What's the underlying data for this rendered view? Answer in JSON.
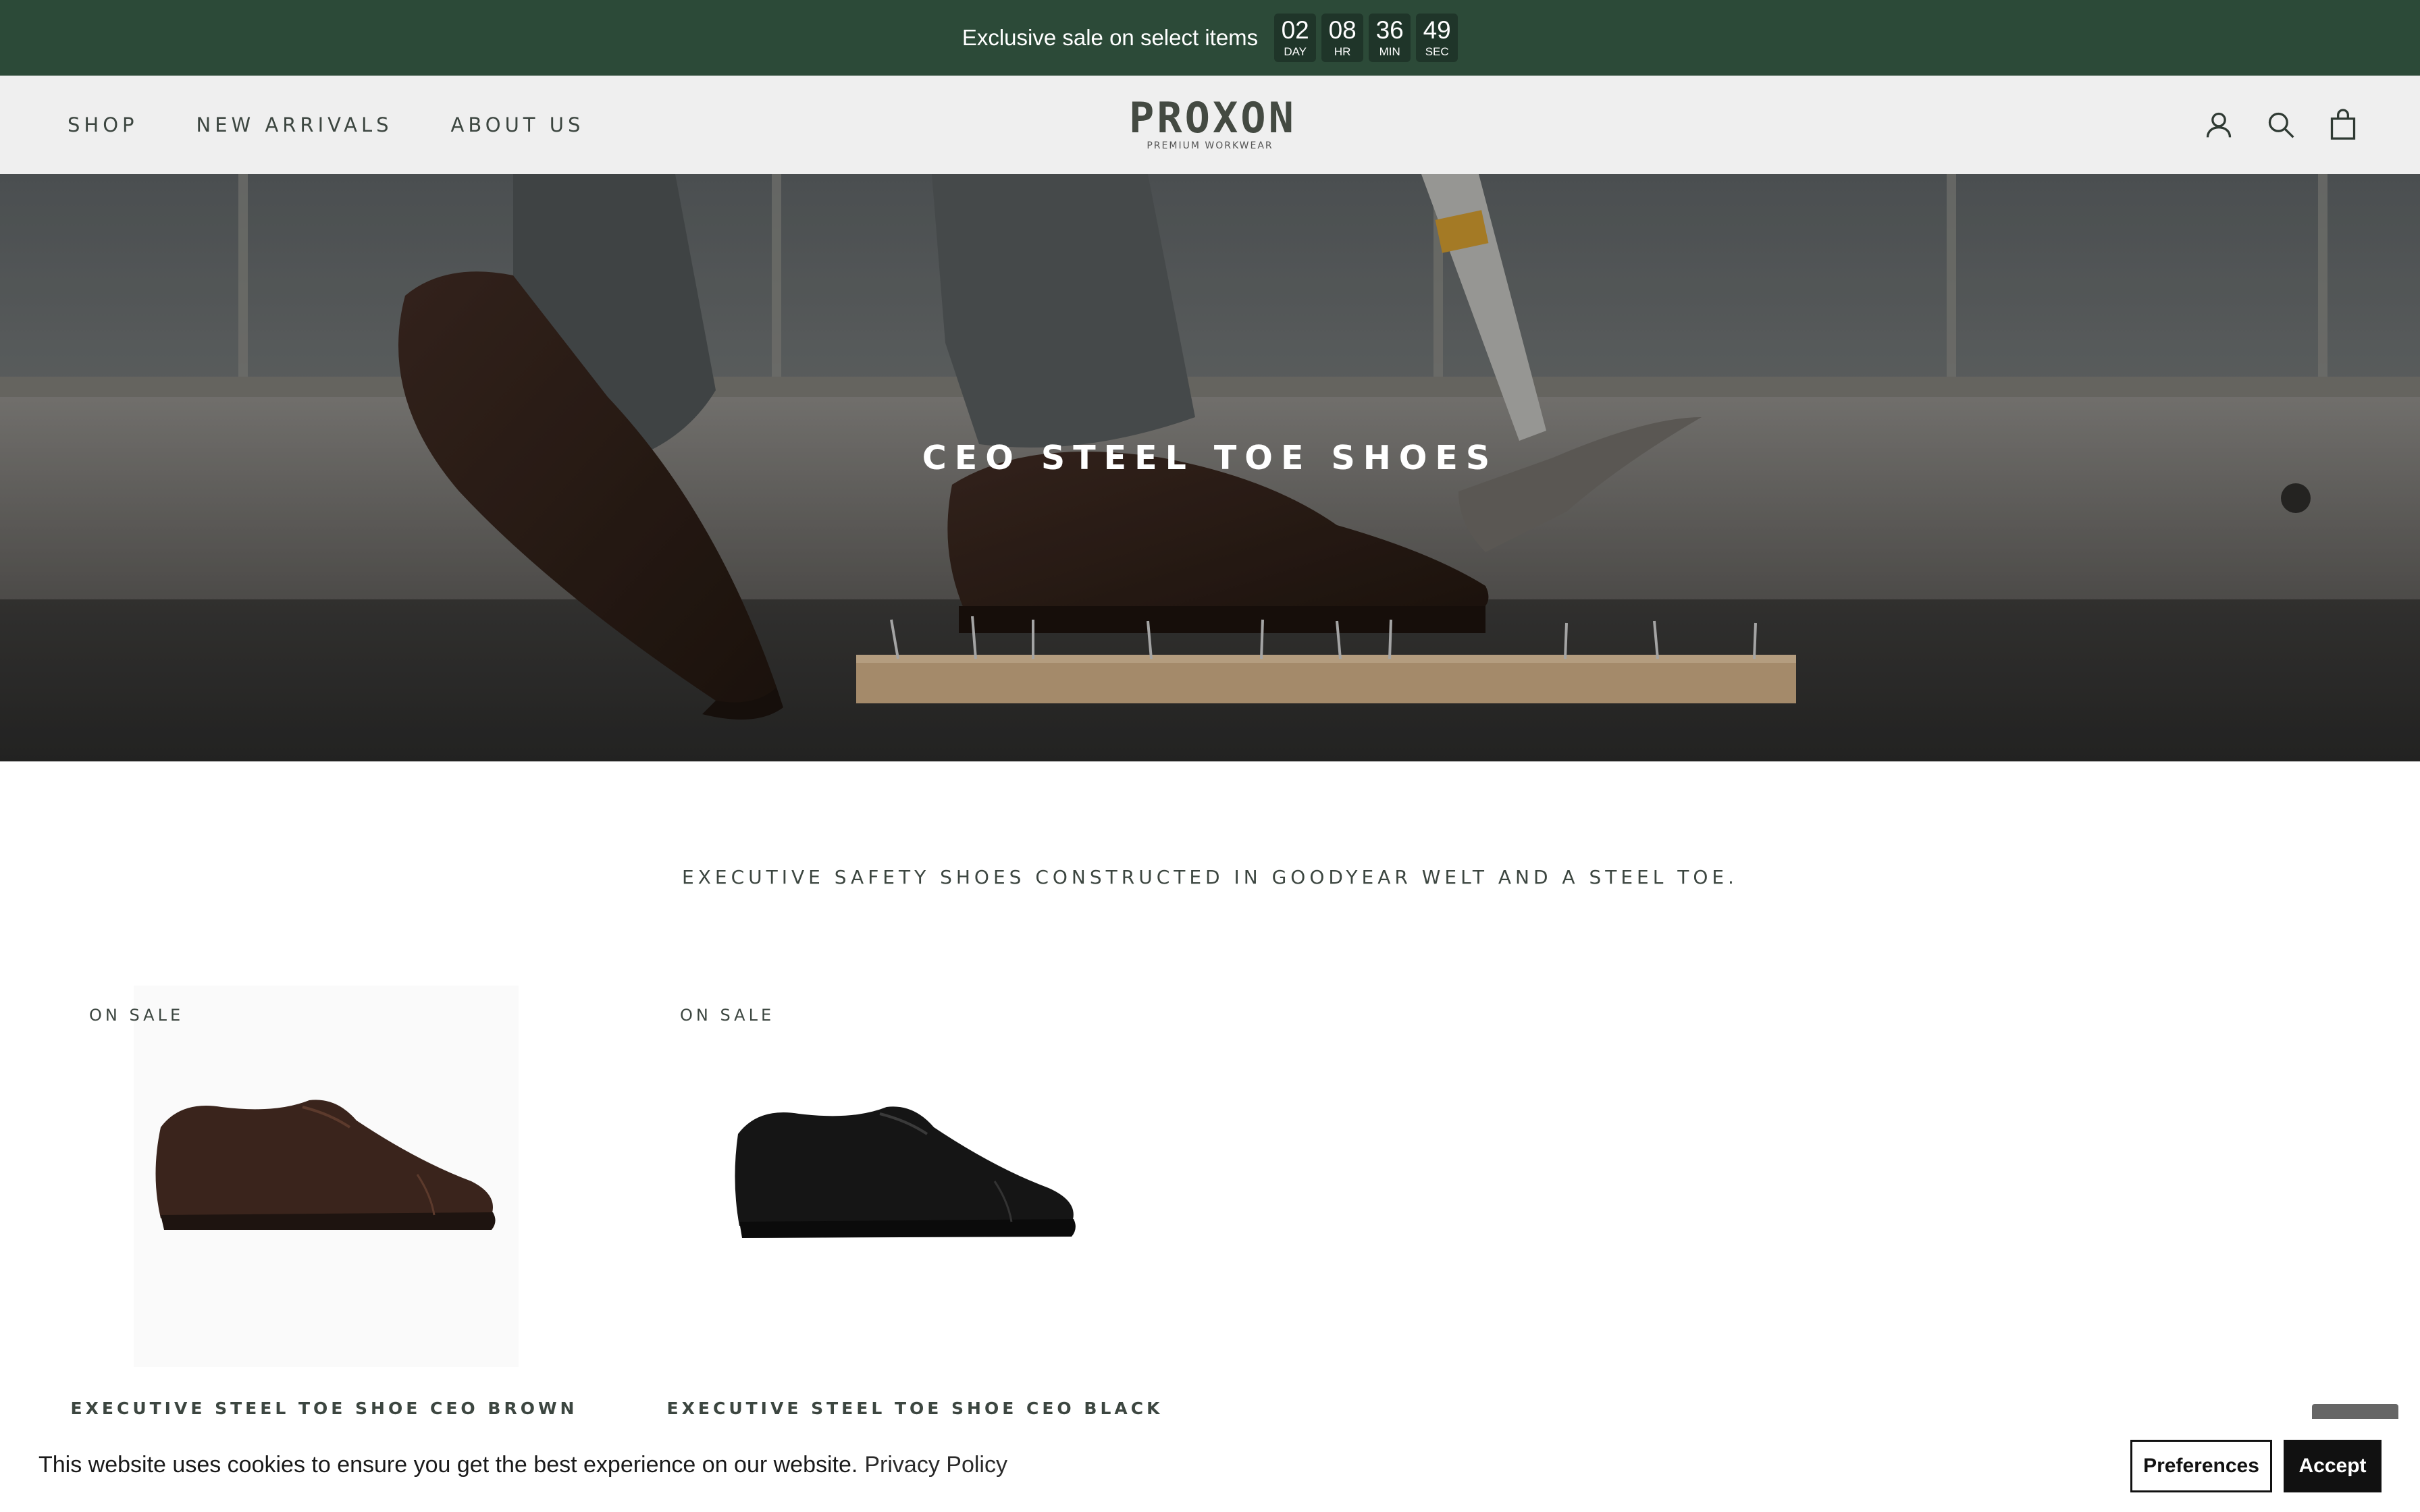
{
  "announcement": {
    "text": "Exclusive sale on select items",
    "countdown": [
      {
        "value": "02",
        "unit": "DAY"
      },
      {
        "value": "08",
        "unit": "HR"
      },
      {
        "value": "36",
        "unit": "MIN"
      },
      {
        "value": "49",
        "unit": "SEC"
      }
    ],
    "bg_color": "#2c4a38"
  },
  "header": {
    "nav": [
      {
        "label": "SHOP"
      },
      {
        "label": "NEW ARRIVALS"
      },
      {
        "label": "ABOUT US"
      }
    ],
    "logo": {
      "text": "PROXON",
      "tagline": "PREMIUM WORKWEAR"
    },
    "icons": [
      "account-icon",
      "search-icon",
      "cart-icon"
    ]
  },
  "hero": {
    "title": "CEO STEEL TOE SHOES"
  },
  "collection": {
    "description": "EXECUTIVE SAFETY SHOES CONSTRUCTED IN GOODYEAR WELT AND A STEEL TOE.",
    "products": [
      {
        "badge": "ON SALE",
        "name": "EXECUTIVE STEEL TOE SHOE CEO BROWN",
        "color": "#3a241c"
      },
      {
        "badge": "ON SALE",
        "name": "EXECUTIVE STEEL TOE SHOE CEO BLACK",
        "color": "#151515"
      }
    ]
  },
  "cookie_banner": {
    "text": "This website uses cookies to ensure you get the best experience on our website.",
    "link": "Privacy Policy",
    "preferences_label": "Preferences",
    "accept_label": "Accept"
  }
}
